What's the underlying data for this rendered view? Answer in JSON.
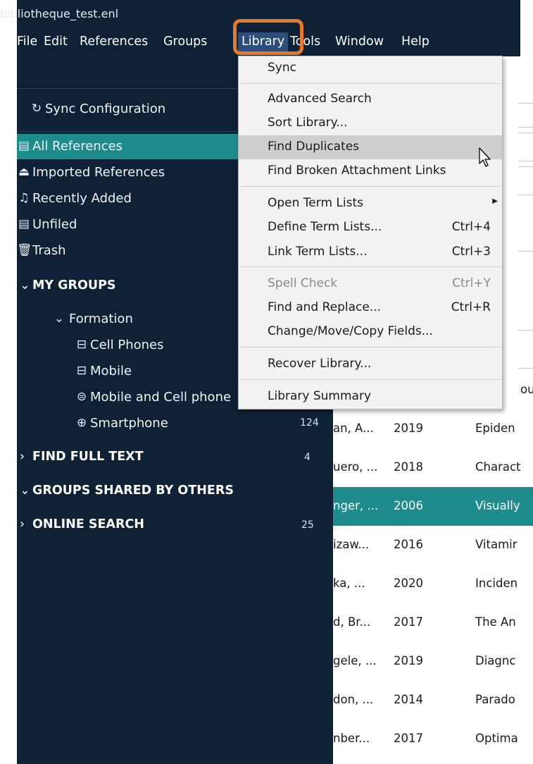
{
  "window": {
    "title": "bibliotheque_test.enl"
  },
  "menubar": [
    "File",
    "Edit",
    "References",
    "Groups",
    "Library",
    "Tools",
    "Window",
    "Help"
  ],
  "sidebar": {
    "sync": "Sync Configuration",
    "items": [
      {
        "label": "All References",
        "icon": "document-icon"
      },
      {
        "label": "Imported References",
        "icon": "import-icon"
      },
      {
        "label": "Recently Added",
        "icon": "bell-icon"
      },
      {
        "label": "Unfiled",
        "icon": "document-icon"
      },
      {
        "label": "Trash",
        "icon": "trash-icon"
      }
    ],
    "my_groups": "MY GROUPS",
    "group_set": "Formation",
    "groups": [
      {
        "label": "Cell Phones",
        "count": ""
      },
      {
        "label": "Mobile",
        "count": ""
      },
      {
        "label": "Mobile and Cell phone",
        "count": ""
      },
      {
        "label": "Smartphone",
        "count": "124"
      }
    ],
    "find_full_text": {
      "label": "FIND FULL TEXT",
      "count": "4"
    },
    "shared": "GROUPS SHARED BY OTHERS",
    "online_search": {
      "label": "ONLINE SEARCH",
      "count": "25"
    }
  },
  "library_menu": {
    "items": [
      {
        "label": "Sync",
        "shortcut": ""
      },
      {
        "label": "Advanced Search",
        "shortcut": ""
      },
      {
        "label": "Sort Library...",
        "shortcut": ""
      },
      {
        "label": "Find Duplicates",
        "shortcut": ""
      },
      {
        "label": "Find Broken Attachment Links",
        "shortcut": ""
      },
      {
        "label": "Open Term Lists",
        "shortcut": ""
      },
      {
        "label": "Define Term Lists...",
        "shortcut": "Ctrl+4"
      },
      {
        "label": "Link Term Lists...",
        "shortcut": "Ctrl+3"
      },
      {
        "label": "Spell Check",
        "shortcut": "Ctrl+Y"
      },
      {
        "label": "Find and Replace...",
        "shortcut": "Ctrl+R"
      },
      {
        "label": "Change/Move/Copy Fields...",
        "shortcut": ""
      },
      {
        "label": "Recover Library...",
        "shortcut": ""
      },
      {
        "label": "Library Summary",
        "shortcut": ""
      }
    ]
  },
  "references": [
    {
      "author": "ous",
      "year": "",
      "title": ""
    },
    {
      "author": "an, A...",
      "year": "2019",
      "title": "Epiden"
    },
    {
      "author": "uero, ...",
      "year": "2018",
      "title": "Charact"
    },
    {
      "author": "nger, ...",
      "year": "2006",
      "title": "Visually"
    },
    {
      "author": "izaw...",
      "year": "2016",
      "title": "Vitamir"
    },
    {
      "author": "ka, ...",
      "year": "2020",
      "title": "Inciden"
    },
    {
      "author": "d, Br...",
      "year": "2017",
      "title": "The An"
    },
    {
      "author": "gele, ...",
      "year": "2019",
      "title": "Diagnc"
    },
    {
      "author": "don, ...",
      "year": "2014",
      "title": "Parado"
    },
    {
      "author": "nber...",
      "year": "2017",
      "title": "Optima"
    }
  ],
  "colors": {
    "sidebar_bg": "#0e2135",
    "selection": "#1e8c8c",
    "highlight": "#e8782e"
  }
}
